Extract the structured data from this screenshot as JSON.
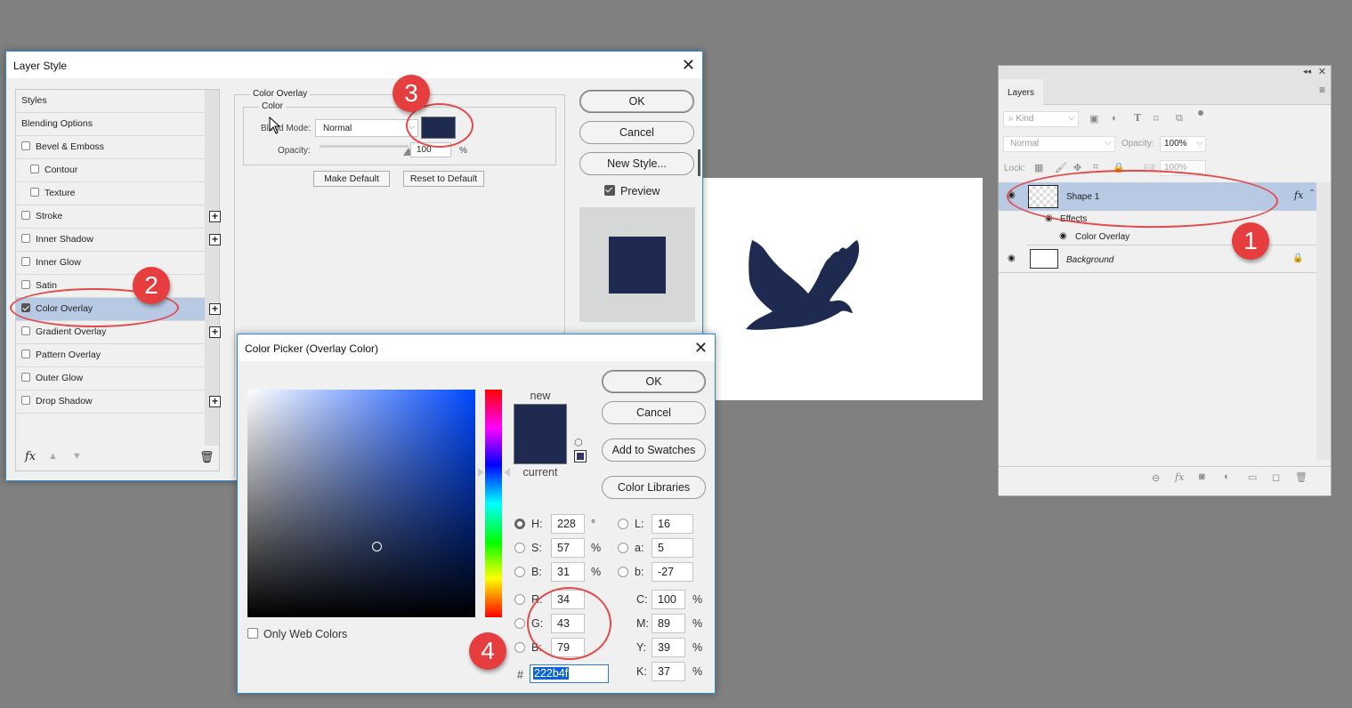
{
  "layer_style": {
    "title": "Layer Style",
    "list_items": [
      {
        "label": "Styles",
        "checkbox": false,
        "indent": 0,
        "plus": false
      },
      {
        "label": "Blending Options",
        "checkbox": false,
        "indent": 0,
        "plus": false
      },
      {
        "label": "Bevel & Emboss",
        "checkbox": "off",
        "indent": 0,
        "plus": false
      },
      {
        "label": "Contour",
        "checkbox": "off",
        "indent": 1,
        "plus": false
      },
      {
        "label": "Texture",
        "checkbox": "off",
        "indent": 1,
        "plus": false
      },
      {
        "label": "Stroke",
        "checkbox": "off",
        "indent": 0,
        "plus": true
      },
      {
        "label": "Inner Shadow",
        "checkbox": "off",
        "indent": 0,
        "plus": true
      },
      {
        "label": "Inner Glow",
        "checkbox": "off",
        "indent": 0,
        "plus": false
      },
      {
        "label": "Satin",
        "checkbox": "off",
        "indent": 0,
        "plus": false
      },
      {
        "label": "Color Overlay",
        "checkbox": "on",
        "indent": 0,
        "plus": true,
        "selected": true
      },
      {
        "label": "Gradient Overlay",
        "checkbox": "off",
        "indent": 0,
        "plus": true
      },
      {
        "label": "Pattern Overlay",
        "checkbox": "off",
        "indent": 0,
        "plus": false
      },
      {
        "label": "Outer Glow",
        "checkbox": "off",
        "indent": 0,
        "plus": false
      },
      {
        "label": "Drop Shadow",
        "checkbox": "off",
        "indent": 0,
        "plus": true
      }
    ],
    "fx_label": "fx",
    "section_title": "Color Overlay",
    "subsection_title": "Color",
    "blend_mode_label": "Blend Mode:",
    "blend_mode_value": "Normal",
    "opacity_label": "Opacity:",
    "opacity_value": "100",
    "opacity_unit": "%",
    "opacity_fraction": 1.0,
    "overlay_color": "#1e2a4f",
    "make_default": "Make Default",
    "reset_default": "Reset to Default",
    "ok": "OK",
    "cancel": "Cancel",
    "new_style": "New Style...",
    "preview_label": "Preview",
    "preview_checked": true
  },
  "color_picker": {
    "title": "Color Picker (Overlay Color)",
    "new_label": "new",
    "current_label": "current",
    "ok": "OK",
    "cancel": "Cancel",
    "add_swatches": "Add to Swatches",
    "color_libraries": "Color Libraries",
    "only_web_colors": "Only Web Colors",
    "hsb": [
      {
        "label": "H:",
        "value": "228",
        "unit": "°",
        "selected": true
      },
      {
        "label": "S:",
        "value": "57",
        "unit": "%"
      },
      {
        "label": "B:",
        "value": "31",
        "unit": "%"
      }
    ],
    "rgb": [
      {
        "label": "R:",
        "value": "34"
      },
      {
        "label": "G:",
        "value": "43"
      },
      {
        "label": "B:",
        "value": "79"
      }
    ],
    "lab": [
      {
        "label": "L:",
        "value": "16"
      },
      {
        "label": "a:",
        "value": "5"
      },
      {
        "label": "b:",
        "value": "-27"
      }
    ],
    "cmyk": [
      {
        "label": "C:",
        "value": "100",
        "unit": "%"
      },
      {
        "label": "M:",
        "value": "89",
        "unit": "%"
      },
      {
        "label": "Y:",
        "value": "39",
        "unit": "%"
      },
      {
        "label": "K:",
        "value": "37",
        "unit": "%"
      }
    ],
    "hex_label": "#",
    "hex_value": "222b4f",
    "new_color": "#1e2a4f",
    "current_color": "#1e2a4f",
    "hue_color": "#0048ff"
  },
  "layers_panel": {
    "tab": "Layers",
    "filter_kind": "Kind",
    "blend_mode": "Normal",
    "opacity_label": "Opacity:",
    "opacity_value": "100%",
    "lock_label": "Lock:",
    "fill_label": "Fill:",
    "fill_value": "100%",
    "layers": [
      {
        "name": "Shape 1",
        "selected": true,
        "fx": "fx"
      },
      {
        "name": "Effects"
      },
      {
        "name": "Color Overlay"
      },
      {
        "name": "Background",
        "locked": true
      }
    ]
  },
  "annotations": [
    "1",
    "2",
    "3",
    "4"
  ],
  "accent_color": "#e63e3e"
}
